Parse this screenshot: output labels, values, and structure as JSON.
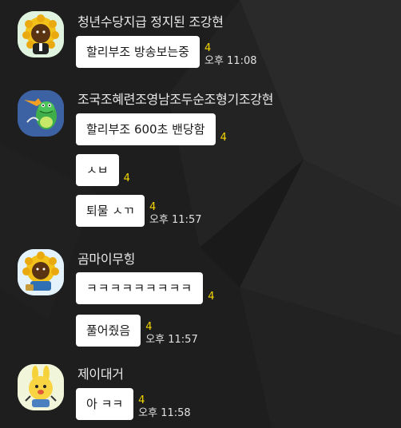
{
  "messages": [
    {
      "sender": "청년수당지급 정지된 조강현",
      "avatar_icon": "sunflower-bear-avatar-icon",
      "bubbles": [
        {
          "text": "할리부조 방송보는중",
          "unread": "4",
          "time": "오후 11:08"
        }
      ]
    },
    {
      "sender": "조국조혜련조영남조두순조형기조강현",
      "avatar_icon": "green-crocodile-avatar-icon",
      "bubbles": [
        {
          "text": "할리부조 600초 밴당함",
          "unread": "4",
          "time": ""
        },
        {
          "text": "ㅅㅂ",
          "unread": "4",
          "time": ""
        },
        {
          "text": "퇴물 ㅅㄲ",
          "unread": "4",
          "time": "오후 11:57"
        }
      ]
    },
    {
      "sender": "곰마이무힝",
      "avatar_icon": "sunflower-bear-laptop-avatar-icon",
      "bubbles": [
        {
          "text": "ㅋㅋㅋㅋㅋㅋㅋㅋㅋ",
          "unread": "4",
          "time": ""
        },
        {
          "text": "풀어줬음",
          "unread": "4",
          "time": "오후 11:57"
        }
      ]
    },
    {
      "sender": "제이대거",
      "avatar_icon": "yellow-bunny-avatar-icon",
      "bubbles": [
        {
          "text": "아 ㅋㅋ",
          "unread": "4",
          "time": "오후 11:58"
        }
      ]
    }
  ],
  "colors": {
    "background": "#1e1e1f",
    "bubble": "#ffffff",
    "unread": "#f6d600",
    "text_light": "#e8e8e8"
  }
}
